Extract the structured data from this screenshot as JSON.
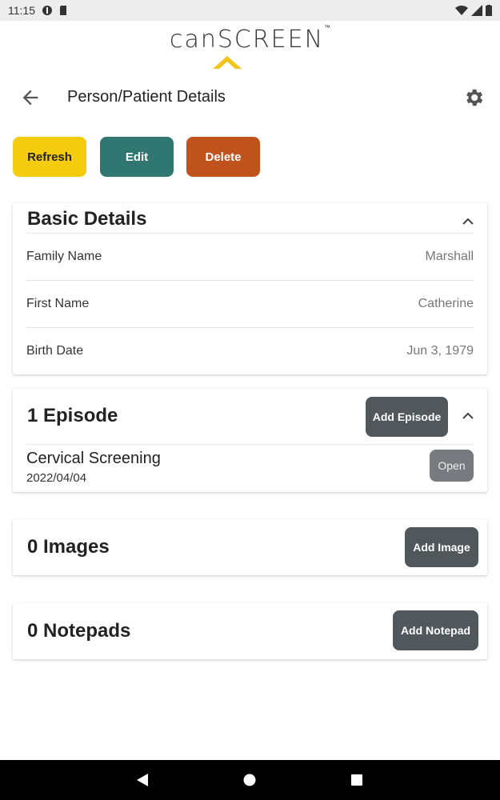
{
  "status_bar": {
    "time": "11:15"
  },
  "app": {
    "logo_text": "canSCREEN",
    "logo_tm": "™"
  },
  "header": {
    "title": "Person/Patient Details"
  },
  "actions": {
    "refresh_label": "Refresh",
    "edit_label": "Edit",
    "delete_label": "Delete"
  },
  "basic_details": {
    "title": "Basic Details",
    "fields": [
      {
        "label": "Family Name",
        "value": "Marshall"
      },
      {
        "label": "First Name",
        "value": "Catherine"
      },
      {
        "label": "Birth Date",
        "value": "Jun 3, 1979"
      }
    ]
  },
  "episodes": {
    "title": "1 Episode",
    "add_label": "Add Episode",
    "items": [
      {
        "name": "Cervical Screening",
        "date": "2022/04/04",
        "open_label": "Open"
      }
    ]
  },
  "images": {
    "title": "0 Images",
    "add_label": "Add Image"
  },
  "notepads": {
    "title": "0 Notepads",
    "add_label": "Add Notepad"
  },
  "colors": {
    "refresh": "#f5cc0d",
    "edit": "#2f7770",
    "delete": "#c0521b",
    "logo_accent": "#f0c419"
  }
}
